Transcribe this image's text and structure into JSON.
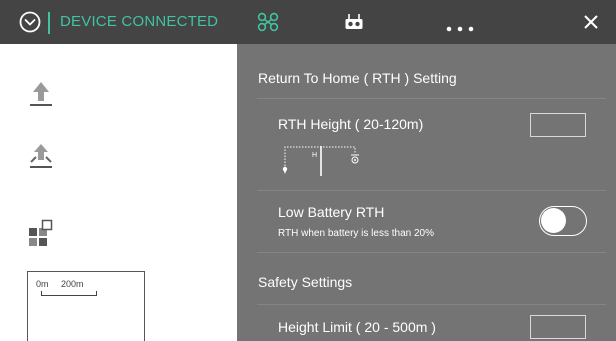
{
  "colors": {
    "accent": "#40c4a0",
    "topbar_bg": "#444444",
    "panel_bg": "#747474",
    "text_light": "#ffffff"
  },
  "header": {
    "status_text": "DEVICE CONNECTED",
    "home_icon": "circle-chevron-down-icon",
    "tabs": [
      {
        "icon": "drone-icon",
        "active": true
      },
      {
        "icon": "remote-controller-icon",
        "active": false
      },
      {
        "icon": "more-dots-icon",
        "active": false
      }
    ],
    "close_icon": "close-icon"
  },
  "sidebar": {
    "buttons": [
      {
        "icon": "takeoff-icon"
      },
      {
        "icon": "landing-icon"
      },
      {
        "icon": "layout-toggle-icon"
      }
    ],
    "map": {
      "scale_start": "0m",
      "scale_end": "200m"
    }
  },
  "settings": {
    "rth_section_title": "Return To Home ( RTH ) Setting",
    "rth_height_label": "RTH Height ( 20-120m)",
    "rth_height_value": "",
    "rth_diagram_label": "H",
    "low_battery_label": "Low Battery RTH",
    "low_battery_sub": "RTH when battery is less than 20%",
    "low_battery_on": false,
    "safety_section_title": "Safety Settings",
    "height_limit_label": "Height Limit ( 20 - 500m )",
    "height_limit_value": ""
  }
}
